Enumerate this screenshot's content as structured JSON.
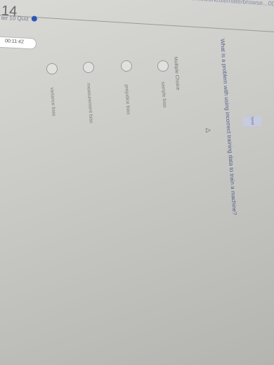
{
  "browser": {
    "url_fragment": "...homework/ultimate/browse...00..."
  },
  "header": {
    "breadcrumb": "ter 10 Quiz",
    "badge_icon": "info-dot",
    "question_number": "14",
    "timer": "00:11:42"
  },
  "question": {
    "prompt": "What is a problem with using incorrect training data to train a machine?",
    "type_label": "Multiple Choice",
    "options": [
      {
        "label": "sample bias"
      },
      {
        "label": "prejudice bias"
      },
      {
        "label": "measurement bias"
      },
      {
        "label": "variance bias"
      }
    ]
  },
  "actions": {
    "send_label": "Send"
  },
  "colors": {
    "accent": "#2f55b8",
    "text_link": "#55608a",
    "radio_border": "#9a9a9a"
  }
}
